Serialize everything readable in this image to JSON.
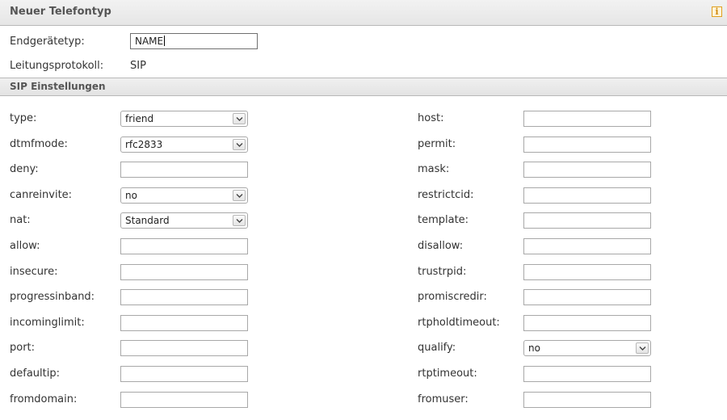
{
  "header": {
    "title": "Neuer Telefontyp"
  },
  "general": {
    "device_type_label": "Endgerätetyp:",
    "device_type_value": "NAME",
    "protocol_label": "Leitungsprotokoll:",
    "protocol_value": "SIP"
  },
  "section": {
    "title": "SIP Einstellungen"
  },
  "left_fields": [
    {
      "label": "type:",
      "kind": "select",
      "value": "friend"
    },
    {
      "label": "dtmfmode:",
      "kind": "select",
      "value": "rfc2833"
    },
    {
      "label": "deny:",
      "kind": "text",
      "value": ""
    },
    {
      "label": "canreinvite:",
      "kind": "select",
      "value": "no"
    },
    {
      "label": "nat:",
      "kind": "select",
      "value": "Standard"
    },
    {
      "label": "allow:",
      "kind": "text",
      "value": ""
    },
    {
      "label": "insecure:",
      "kind": "text",
      "value": ""
    },
    {
      "label": "progressinband:",
      "kind": "text",
      "value": ""
    },
    {
      "label": "incominglimit:",
      "kind": "text",
      "value": ""
    },
    {
      "label": "port:",
      "kind": "text",
      "value": ""
    },
    {
      "label": "defaultip:",
      "kind": "text",
      "value": ""
    },
    {
      "label": "fromdomain:",
      "kind": "text",
      "value": ""
    }
  ],
  "right_fields": [
    {
      "label": "host:",
      "kind": "text",
      "value": ""
    },
    {
      "label": "permit:",
      "kind": "text",
      "value": ""
    },
    {
      "label": "mask:",
      "kind": "text",
      "value": ""
    },
    {
      "label": "restrictcid:",
      "kind": "text",
      "value": ""
    },
    {
      "label": "template:",
      "kind": "text",
      "value": ""
    },
    {
      "label": "disallow:",
      "kind": "text",
      "value": ""
    },
    {
      "label": "trustrpid:",
      "kind": "text",
      "value": ""
    },
    {
      "label": "promiscredir:",
      "kind": "text",
      "value": ""
    },
    {
      "label": "rtpholdtimeout:",
      "kind": "text",
      "value": ""
    },
    {
      "label": "qualify:",
      "kind": "select",
      "value": "no"
    },
    {
      "label": "rtptimeout:",
      "kind": "text",
      "value": ""
    },
    {
      "label": "fromuser:",
      "kind": "text",
      "value": ""
    }
  ],
  "icons": {
    "info": "info-icon",
    "dropdown": "chevron-down-icon"
  }
}
